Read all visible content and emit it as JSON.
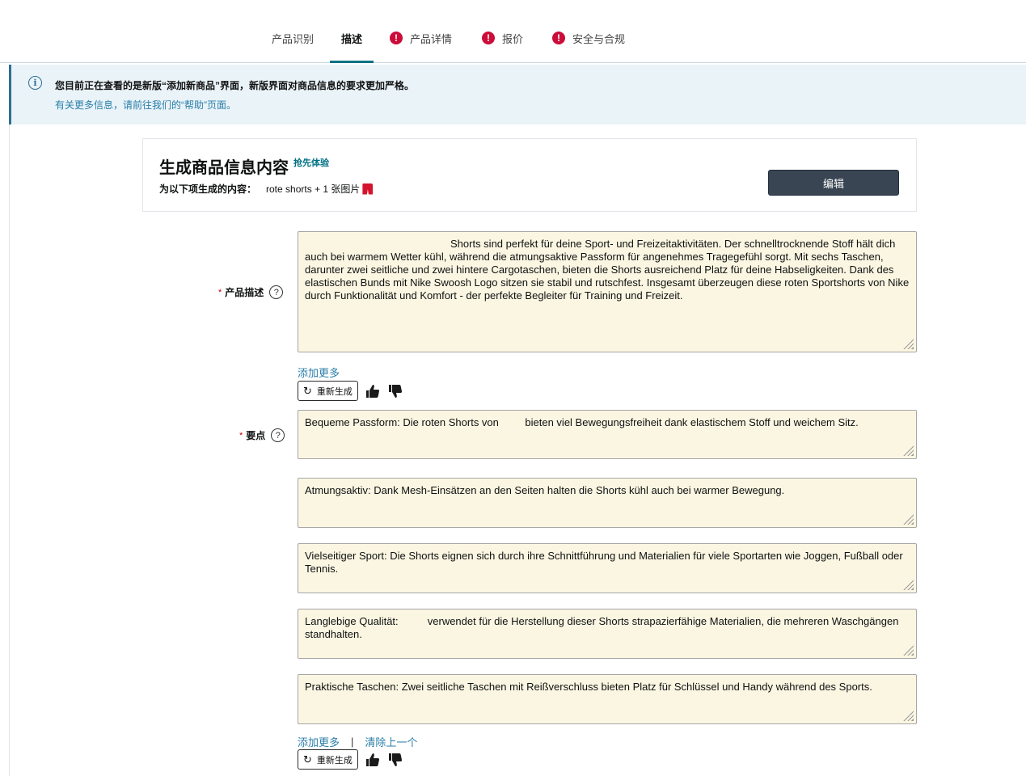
{
  "tabs": [
    {
      "label": "产品识别",
      "warn": false,
      "active": false
    },
    {
      "label": "描述",
      "warn": false,
      "active": true
    },
    {
      "label": "产品详情",
      "warn": true,
      "active": false
    },
    {
      "label": "报价",
      "warn": true,
      "active": false
    },
    {
      "label": "安全与合规",
      "warn": true,
      "active": false
    }
  ],
  "banner": {
    "line1": "您目前正在查看的是新版“添加新商品”界面，新版界面对商品信息的要求更加严格。",
    "line2": "有关更多信息，请前往我们的“帮助”页面。"
  },
  "generate": {
    "title": "生成商品信息内容",
    "badge": "抢先体验",
    "sub_label": "为以下项生成的内容：",
    "sub_value": "rote shorts + 1 张图片",
    "edit_label": "编辑"
  },
  "description": {
    "label": "产品描述",
    "text": "Shorts sind perfekt für deine Sport- und Freizeitaktivitäten. Der schnelltrocknende Stoff hält dich auch bei warmem Wetter kühl, während die atmungsaktive Passform für angenehmes Tragegefühl sorgt. Mit sechs Taschen, darunter zwei seitliche und zwei hintere Cargotaschen, bieten die Shorts ausreichend Platz für deine Habseligkeiten. Dank des elastischen Bunds mit Nike Swoosh Logo sitzen sie stabil und rutschfest. Insgesamt überzeugen diese roten Sportshorts von Nike durch Funktionalität und Komfort - der perfekte Begleiter für Training und Freizeit.",
    "add_more": "添加更多",
    "regen_label": "重新生成"
  },
  "bullets": {
    "label": "要点",
    "items": [
      "Bequeme Passform: Die roten Shorts von         bieten viel Bewegungsfreiheit dank elastischem Stoff und weichem Sitz.",
      "Atmungsaktiv: Dank Mesh-Einsätzen an den Seiten halten die Shorts kühl auch bei warmer Bewegung.",
      "Vielseitiger Sport: Die Shorts eignen sich durch ihre Schnittführung und Materialien für viele Sportarten wie Joggen, Fußball oder Tennis.",
      "Langlebige Qualität:          verwendet für die Herstellung dieser Shorts strapazierfähige Materialien, die mehreren Waschgängen standhalten.",
      "Praktische Taschen: Zwei seitliche Taschen mit Reißverschluss bieten Platz für Schlüssel und Handy während des Sports."
    ],
    "add_more": "添加更多",
    "separator": "|",
    "remove_last": "清除上一个",
    "regen_label": "重新生成"
  },
  "colors": {
    "accent": "#007185",
    "link": "#2a7ea8",
    "warning": "#cc0c39",
    "textarea_bg": "#fbf6e2"
  }
}
